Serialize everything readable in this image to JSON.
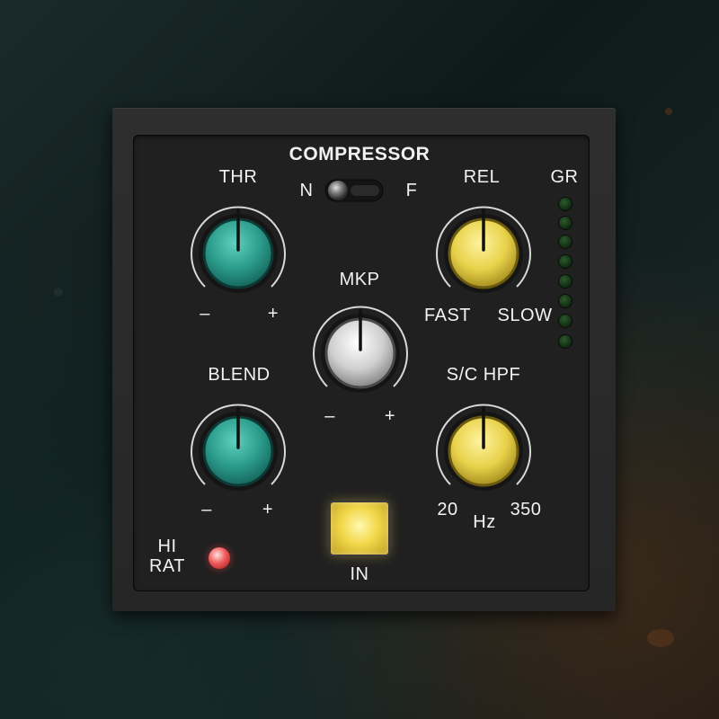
{
  "plugin": {
    "title": "COMPRESSOR",
    "mode_switch": {
      "left_label": "N",
      "right_label": "F",
      "position": "N"
    },
    "knobs": {
      "thr": {
        "label": "THR",
        "min_label": "–",
        "max_label": "+",
        "color": "#2a9a8a"
      },
      "rel": {
        "label": "REL",
        "min_label": "FAST",
        "max_label": "SLOW",
        "color": "#e8d24a"
      },
      "mkp": {
        "label": "MKP",
        "min_label": "–",
        "max_label": "+",
        "color": "#cfcfcf"
      },
      "blend": {
        "label": "BLEND",
        "min_label": "–",
        "max_label": "+",
        "color": "#2a9a8a"
      },
      "sc_hpf": {
        "label": "S/C HPF",
        "min_label": "20",
        "max_label": "350",
        "unit": "Hz",
        "color": "#e8d24a"
      }
    },
    "gr_meter": {
      "label": "GR",
      "led_count": 8
    },
    "in_button": {
      "label": "IN",
      "state": "on"
    },
    "hi_rat": {
      "label_line1": "HI",
      "label_line2": "RAT",
      "state": "on"
    }
  }
}
